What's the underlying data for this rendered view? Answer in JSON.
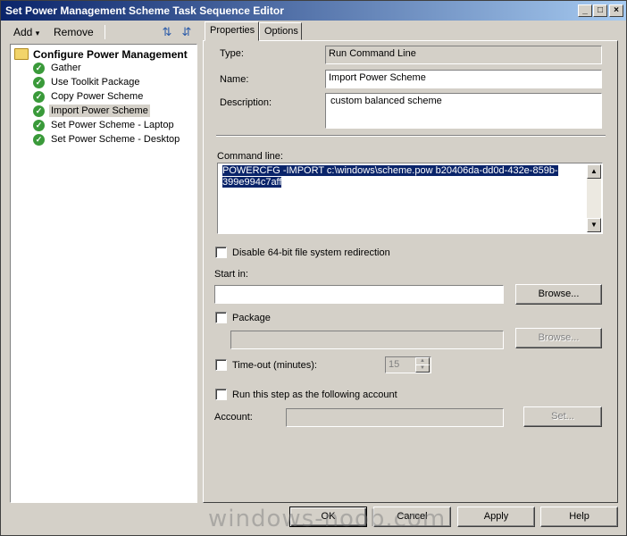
{
  "window": {
    "title": "Set Power Management Scheme Task Sequence Editor",
    "controls": {
      "minimize": "_",
      "maximize": "□",
      "close": "×"
    }
  },
  "toolbar": {
    "add_label": "Add",
    "add_arrow": "▾",
    "remove_label": "Remove",
    "move_up_icon": "⇅",
    "move_down_icon": "⇵"
  },
  "tree": {
    "root": "Configure Power Management",
    "items": [
      {
        "label": "Gather"
      },
      {
        "label": "Use Toolkit Package"
      },
      {
        "label": "Copy Power Scheme"
      },
      {
        "label": "Import Power Scheme",
        "selected": true
      },
      {
        "label": "Set Power Scheme - Laptop"
      },
      {
        "label": "Set Power Scheme - Desktop"
      }
    ],
    "check_glyph": "✓"
  },
  "tabs": [
    {
      "label": "Properties",
      "active": true
    },
    {
      "label": "Options",
      "active": false
    }
  ],
  "properties": {
    "type_label": "Type:",
    "type_value": "Run Command Line",
    "name_label": "Name:",
    "name_value": "Import Power Scheme",
    "description_label": "Description:",
    "description_value": "custom balanced scheme",
    "command_line_label": "Command line:",
    "command_line_value": "POWERCFG -IMPORT c:\\windows\\scheme.pow b20406da-dd0d-432e-859b-399e994c7aff",
    "disable_redirection_label": "Disable 64-bit file system redirection",
    "start_in_label": "Start in:",
    "start_in_value": "",
    "browse_label": "Browse...",
    "package_label": "Package",
    "package_value": "",
    "package_browse_label": "Browse...",
    "timeout_label": "Time-out (minutes):",
    "timeout_value": "15",
    "run_as_label": "Run this step as the following account",
    "account_label": "Account:",
    "account_value": "",
    "set_label": "Set..."
  },
  "buttons": {
    "ok": "OK",
    "cancel": "Cancel",
    "apply": "Apply",
    "help": "Help"
  },
  "watermark": "windows-noob.com"
}
